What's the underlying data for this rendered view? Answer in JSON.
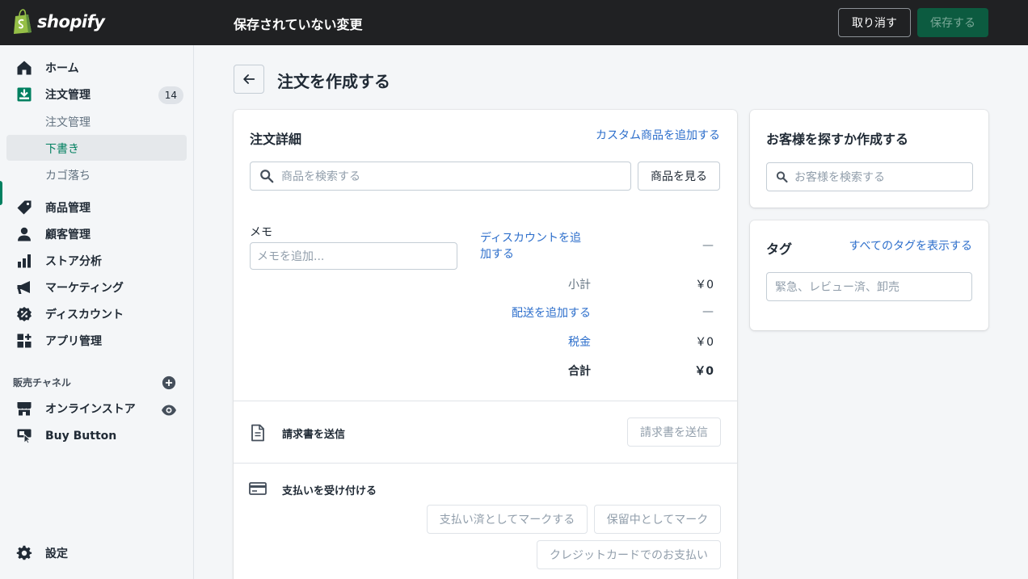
{
  "topbar": {
    "logo_text": "shopify",
    "title": "保存されていない変更",
    "discard_label": "取り消す",
    "save_label": "保存する"
  },
  "sidebar": {
    "items": [
      {
        "label": "ホーム",
        "icon": "home-icon"
      },
      {
        "label": "注文管理",
        "icon": "orders-icon",
        "badge": "14"
      },
      {
        "label": "商品管理",
        "icon": "tag-icon"
      },
      {
        "label": "顧客管理",
        "icon": "person-icon"
      },
      {
        "label": "ストア分析",
        "icon": "bar-chart-icon"
      },
      {
        "label": "マーケティング",
        "icon": "megaphone-icon"
      },
      {
        "label": "ディスカウント",
        "icon": "discount-icon"
      },
      {
        "label": "アプリ管理",
        "icon": "apps-icon"
      }
    ],
    "order_subitems": [
      "注文管理",
      "下書き",
      "カゴ落ち"
    ],
    "active_subitem": "下書き",
    "channels_label": "販売チャネル",
    "channels": [
      {
        "label": "オンラインストア",
        "icon": "store-icon"
      },
      {
        "label": "Buy Button",
        "icon": "buy-button-icon"
      }
    ],
    "settings_label": "設定"
  },
  "page": {
    "title": "注文を作成する"
  },
  "order_details": {
    "title": "注文詳細",
    "add_custom_link": "カスタム商品を追加する",
    "search_placeholder": "商品を検索する",
    "browse_label": "商品を見る",
    "memo_label": "メモ",
    "memo_placeholder": "メモを追加...",
    "discount_link_line1": "ディスカウントを追",
    "discount_link_line2": "加する",
    "discount_value": "—",
    "subtotal_label": "小計",
    "subtotal_value": "￥0",
    "shipping_link": "配送を追加する",
    "shipping_value": "—",
    "tax_label": "税金",
    "tax_value": "￥0",
    "total_label": "合計",
    "total_value": "￥0"
  },
  "invoice": {
    "title": "請求書を送信",
    "button_label": "請求書を送信"
  },
  "payment": {
    "title": "支払いを受け付ける",
    "mark_paid_label": "支払い済としてマークする",
    "mark_pending_label": "保留中としてマーク",
    "credit_card_label": "クレジットカードでのお支払い"
  },
  "customer": {
    "title": "お客様を探すか作成する",
    "search_placeholder": "お客様を検索する"
  },
  "tags": {
    "title": "タグ",
    "view_all_link": "すべてのタグを表示する",
    "placeholder": "緊急、レビュー済、卸売"
  },
  "colors": {
    "topbar": "#202123",
    "accent_green": "#008060",
    "link_blue": "#2c6ecb"
  }
}
